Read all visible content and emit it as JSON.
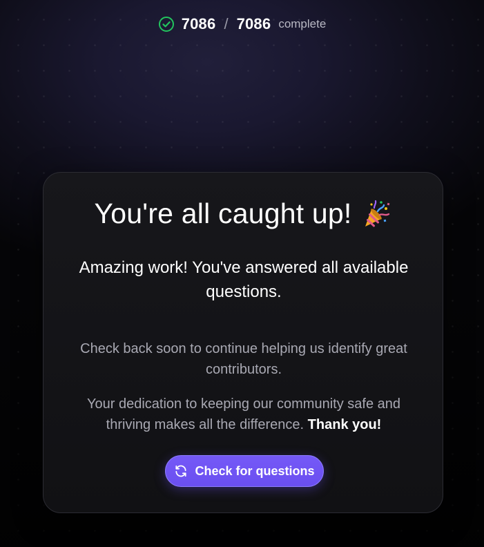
{
  "progress": {
    "answered": "7086",
    "separator": "/",
    "total": "7086",
    "status_label": "complete",
    "icon": "check-circle-icon",
    "accent_color": "#22c55e"
  },
  "card": {
    "title": "You're all caught up!",
    "title_icon": "party-popper-icon",
    "lead": "Amazing work! You've answered all available questions.",
    "note_1": "Check back soon to continue helping us identify great contributors.",
    "note_2": "Your dedication to keeping our community safe and thriving makes all the difference.",
    "note_2_emphasis": "Thank you!",
    "button": {
      "label": "Check for questions",
      "icon": "refresh-icon",
      "color": "#6e55f5"
    }
  }
}
